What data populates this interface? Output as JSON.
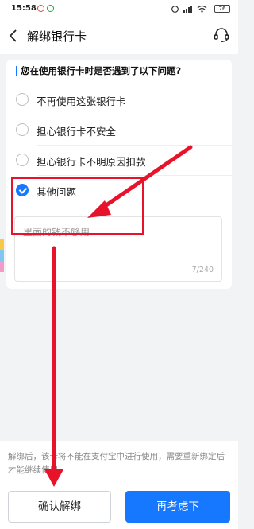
{
  "status_bar": {
    "time": "15:58",
    "battery": "76"
  },
  "header": {
    "title": "解绑银行卡",
    "back_icon": "chevron-left-icon",
    "support_icon": "headset-icon"
  },
  "survey": {
    "question": "您在使用银行卡时是否遇到了以下问题?",
    "options": [
      {
        "label": "不再使用这张银行卡",
        "checked": false
      },
      {
        "label": "担心银行卡不安全",
        "checked": false
      },
      {
        "label": "担心银行卡不明原因扣款",
        "checked": false
      },
      {
        "label": "其他问题",
        "checked": true
      }
    ],
    "other_reason": {
      "value": "里面的钱不够用",
      "char_count": "7/240"
    }
  },
  "footer": {
    "notice": "解绑后，该卡将不能在支付宝中进行使用，需要重新绑定后才能继续使用",
    "confirm_label": "确认解绑",
    "reconsider_label": "再考虑下"
  },
  "colors": {
    "accent": "#1677ff",
    "annotation": "#e8132b"
  }
}
